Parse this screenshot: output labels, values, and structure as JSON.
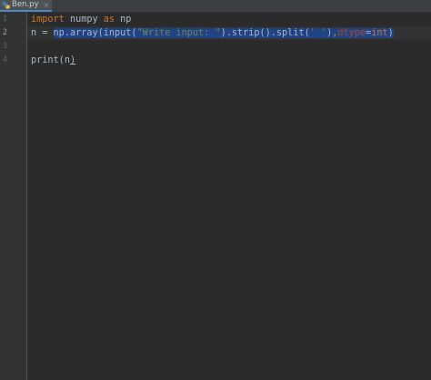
{
  "tab": {
    "label": "Ben.py",
    "close": "×",
    "icon": "python-file-icon"
  },
  "gutter": {
    "line_numbers": [
      "1",
      "2",
      "3",
      "4"
    ],
    "current_line": "2"
  },
  "code": {
    "line1": {
      "kw_import": "import",
      "mod": " numpy ",
      "kw_as": "as",
      "alias": " np"
    },
    "line2": {
      "prefix": "n = ",
      "call1": "np.array(input(",
      "prompt": "\"Write input: \"",
      "call2": ").strip().split(",
      "sep": "' '",
      "comma": ")",
      "comma2": ",",
      "dtype_kw": "dtype",
      "eq": "=",
      "dtype_val": "int",
      "close": ")"
    },
    "line4": {
      "fn": "print(",
      "arg": "n",
      "close": ")"
    }
  },
  "colors": {
    "background": "#2b2b2b",
    "keyword": "#cc7832",
    "string": "#6a8759",
    "selection": "#214283",
    "text": "#a9b7c6"
  }
}
